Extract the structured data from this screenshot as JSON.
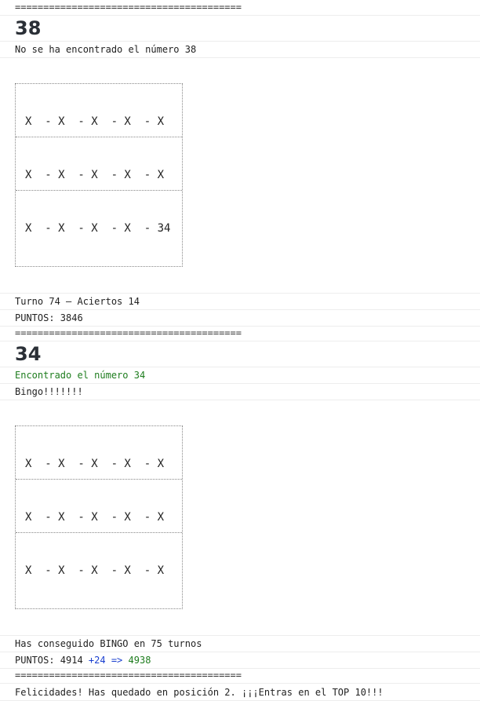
{
  "separator": "========================================",
  "block1": {
    "number": "38",
    "message": "No se ha encontrado el número 38",
    "card_rows": [
      "X  - X  - X  - X  - X",
      "X  - X  - X  - X  - X",
      "X  - X  - X  - X  - 34"
    ],
    "turn": "Turno 74 — Aciertos 14",
    "points": "PUNTOS: 3846"
  },
  "block2": {
    "number": "34",
    "message": "Encontrado el número 34",
    "bingo": "Bingo!!!!!!!",
    "card_rows": [
      "X  - X  - X  - X  - X",
      "X  - X  - X  - X  - X",
      "X  - X  - X  - X  - X"
    ],
    "summary": "Has conseguido BINGO en 75 turnos",
    "points_prefix": "PUNTOS: 4914 ",
    "points_add": "+24",
    "points_arrow": " => ",
    "points_total": "4938"
  },
  "final_message": "Felicidades! Has quedado en posición 2. ¡¡¡Entras en el TOP 10!!!",
  "colors": {
    "found": "#1e7d1e",
    "added": "#1a3fcf",
    "total": "#1e7d1e"
  }
}
